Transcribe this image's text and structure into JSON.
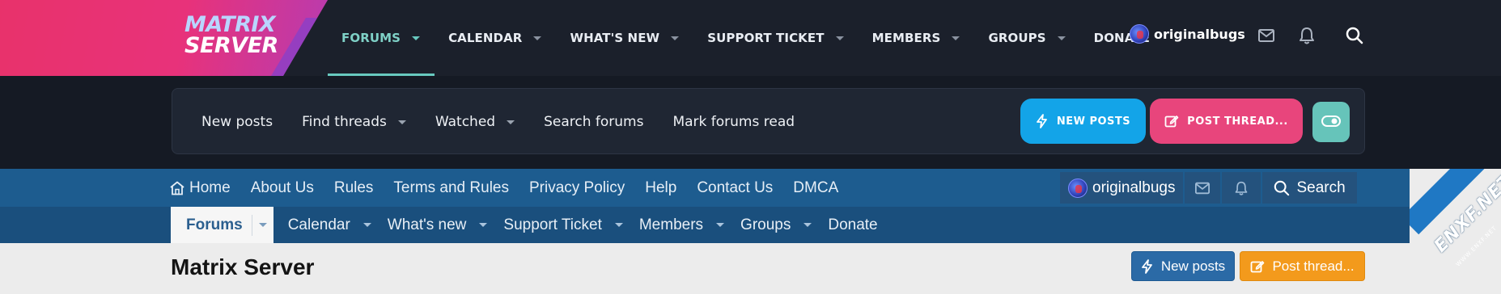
{
  "logo": {
    "line1": "MATRIX",
    "line2": "SERVER"
  },
  "topnav": {
    "items": [
      {
        "label": "FORUMS",
        "active": true,
        "dropdown": true
      },
      {
        "label": "CALENDAR",
        "dropdown": true
      },
      {
        "label": "WHAT'S NEW",
        "dropdown": true
      },
      {
        "label": "SUPPORT TICKET",
        "dropdown": true
      },
      {
        "label": "MEMBERS",
        "dropdown": true
      },
      {
        "label": "GROUPS",
        "dropdown": true
      },
      {
        "label": "DONATE",
        "dropdown": false
      }
    ],
    "username": "originalbugs",
    "icons": [
      "envelope-icon",
      "bell-icon",
      "search-icon"
    ]
  },
  "quicklinks": {
    "items": [
      {
        "label": "New posts",
        "dropdown": false
      },
      {
        "label": "Find threads",
        "dropdown": true
      },
      {
        "label": "Watched",
        "dropdown": true
      },
      {
        "label": "Search forums",
        "dropdown": false
      },
      {
        "label": "Mark forums read",
        "dropdown": false
      }
    ],
    "new_posts_button": "NEW POSTS",
    "post_thread_button": "POST THREAD..."
  },
  "secondary_nav": {
    "home_label": "Home",
    "links": [
      "About Us",
      "Rules",
      "Terms and Rules",
      "Privacy Policy",
      "Help",
      "Contact Us",
      "DMCA"
    ],
    "username": "originalbugs",
    "search_label": "Search"
  },
  "tabs": {
    "items": [
      {
        "label": "Forums",
        "active": true
      },
      {
        "label": "Calendar"
      },
      {
        "label": "What's new"
      },
      {
        "label": "Support Ticket"
      },
      {
        "label": "Members"
      },
      {
        "label": "Groups"
      },
      {
        "label": "Donate"
      }
    ]
  },
  "page": {
    "title": "Matrix Server",
    "new_posts_button": "New posts",
    "post_thread_button": "Post thread..."
  },
  "watermark": {
    "text": "ENXF.NET",
    "sub": "WWW.ENXF.NET"
  },
  "colors": {
    "accent_teal": "#68c9bf",
    "new_posts_blue": "#13a4e8",
    "post_thread_pink": "#e8457c",
    "light_nav_blue": "#1d5c8f",
    "light_post_orange": "#f39a1c"
  }
}
